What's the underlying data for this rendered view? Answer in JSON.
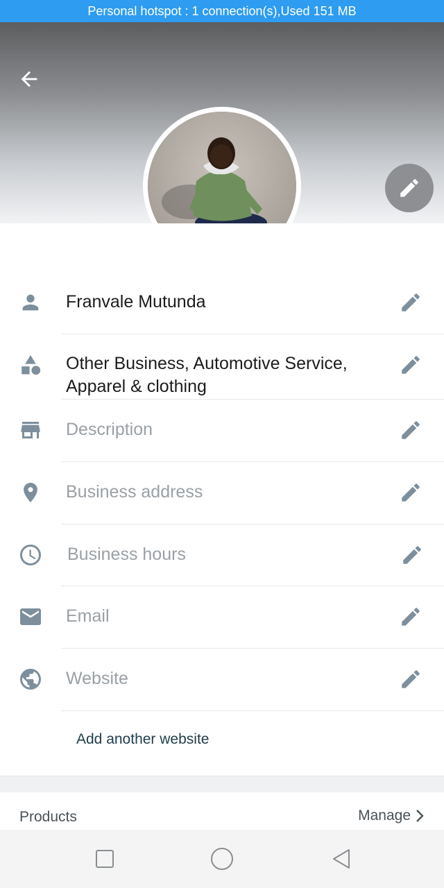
{
  "status_bar": {
    "text": "Personal hotspot : 1 connection(s),Used  151 MB"
  },
  "header": {
    "back_icon": "arrow-back-icon",
    "edit_icon": "pencil-icon"
  },
  "fields": [
    {
      "id": "name",
      "icon": "person-icon",
      "value": "Franvale Mutunda",
      "placeholder": false
    },
    {
      "id": "category",
      "icon": "shapes-icon",
      "value": "Other Business, Automotive Service, Apparel & clothing",
      "placeholder": false
    },
    {
      "id": "description",
      "icon": "store-icon",
      "value": "Description",
      "placeholder": true
    },
    {
      "id": "address",
      "icon": "location-pin-icon",
      "value": "Business address",
      "placeholder": true
    },
    {
      "id": "hours",
      "icon": "clock-icon",
      "value": "Business hours",
      "placeholder": true
    },
    {
      "id": "email",
      "icon": "envelope-icon",
      "value": "Email",
      "placeholder": true
    },
    {
      "id": "website",
      "icon": "globe-icon",
      "value": "Website",
      "placeholder": true
    }
  ],
  "add_website": "Add another website",
  "products": {
    "label": "Products",
    "manage": "Manage"
  },
  "colors": {
    "status_bar": "#2e9cf0",
    "icon_gray": "#7d8f9c",
    "placeholder": "#9aa0a5"
  }
}
